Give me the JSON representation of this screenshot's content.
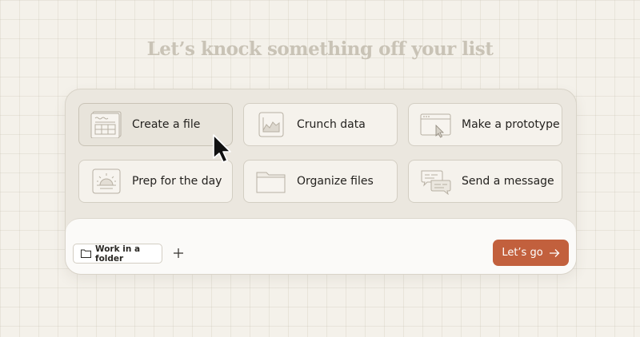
{
  "headline": "Let’s knock something off your list",
  "tiles": [
    {
      "label": "Create a file",
      "icon": "file-table-icon",
      "selected": true
    },
    {
      "label": "Crunch data",
      "icon": "chart-icon",
      "selected": false
    },
    {
      "label": "Make a prototype",
      "icon": "browser-window-icon",
      "selected": false
    },
    {
      "label": "Prep for the day",
      "icon": "sunrise-icon",
      "selected": false
    },
    {
      "label": "Organize files",
      "icon": "folder-icon",
      "selected": false
    },
    {
      "label": "Send a message",
      "icon": "chat-bubbles-icon",
      "selected": false
    }
  ],
  "composer": {
    "folder_button_label": "Work in a folder",
    "add_icon": "plus-icon",
    "submit_label": "Let’s go",
    "submit_icon": "arrow-right-icon"
  },
  "colors": {
    "background": "#f4f1ea",
    "headline": "#c9c3b6",
    "submit_button": "#c2603d"
  }
}
